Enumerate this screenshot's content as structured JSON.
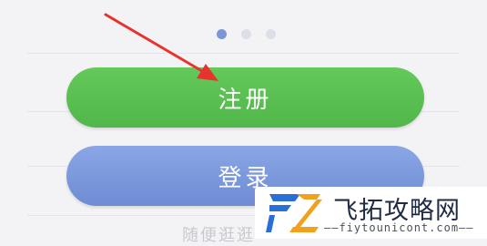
{
  "pager": {
    "count": 3,
    "active_index": 0
  },
  "buttons": {
    "register_label": "注册",
    "login_label": "登录"
  },
  "partial_text": "随便逛逛",
  "watermark": {
    "title": "飞拓攻略网",
    "url": "——fiytounicont.com——",
    "logo_letters": "FZ"
  },
  "colors": {
    "register_green": "#5cc152",
    "login_blue": "#7c98de",
    "annotation_arrow": "#e8322d"
  }
}
